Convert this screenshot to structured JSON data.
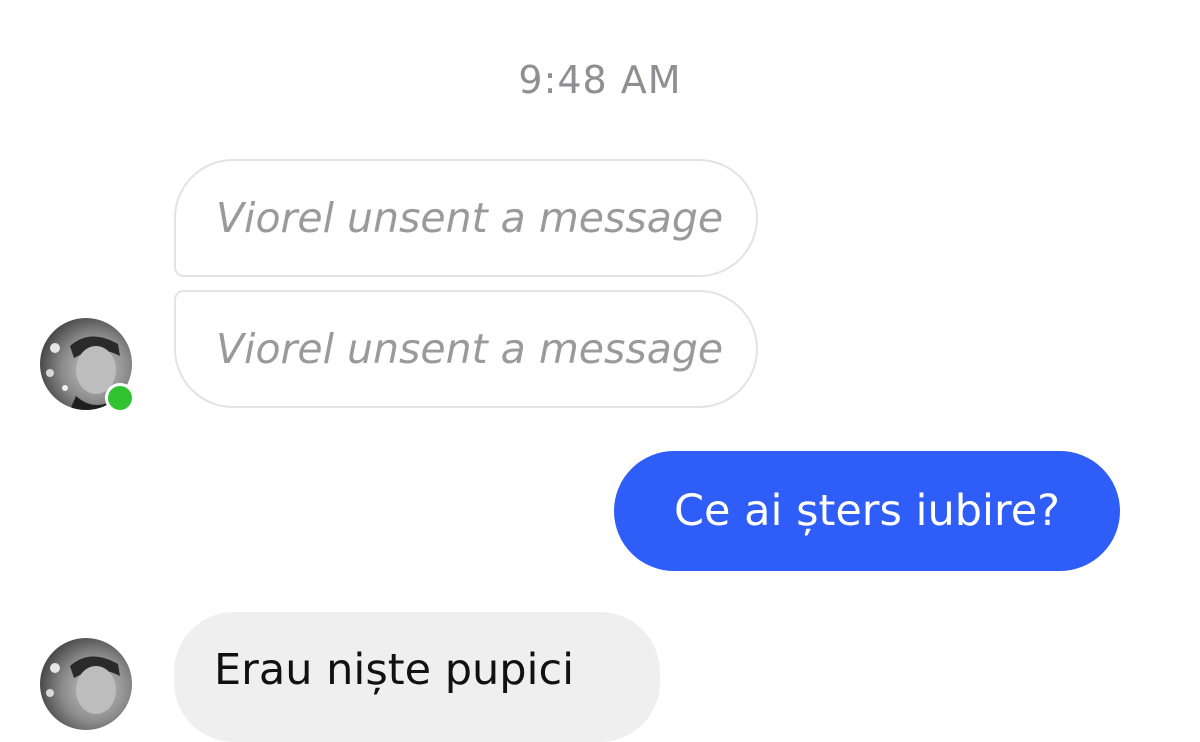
{
  "conversation": {
    "timestamp": "9:48 AM",
    "messages": [
      {
        "sender": "contact",
        "type": "unsent",
        "text": "Viorel unsent a message"
      },
      {
        "sender": "contact",
        "type": "unsent",
        "text": "Viorel unsent a message"
      },
      {
        "sender": "me",
        "type": "text",
        "text": "Ce ai șters iubire?"
      },
      {
        "sender": "contact",
        "type": "text",
        "text": "Erau niște pupici"
      }
    ],
    "contact": {
      "online": true,
      "presence_color": "#31c231"
    }
  },
  "colors": {
    "outgoing_bubble": "#2f5df7",
    "incoming_bubble": "#efefef",
    "timestamp_text": "#8e8e93",
    "unsent_border": "#e3e3e3"
  }
}
